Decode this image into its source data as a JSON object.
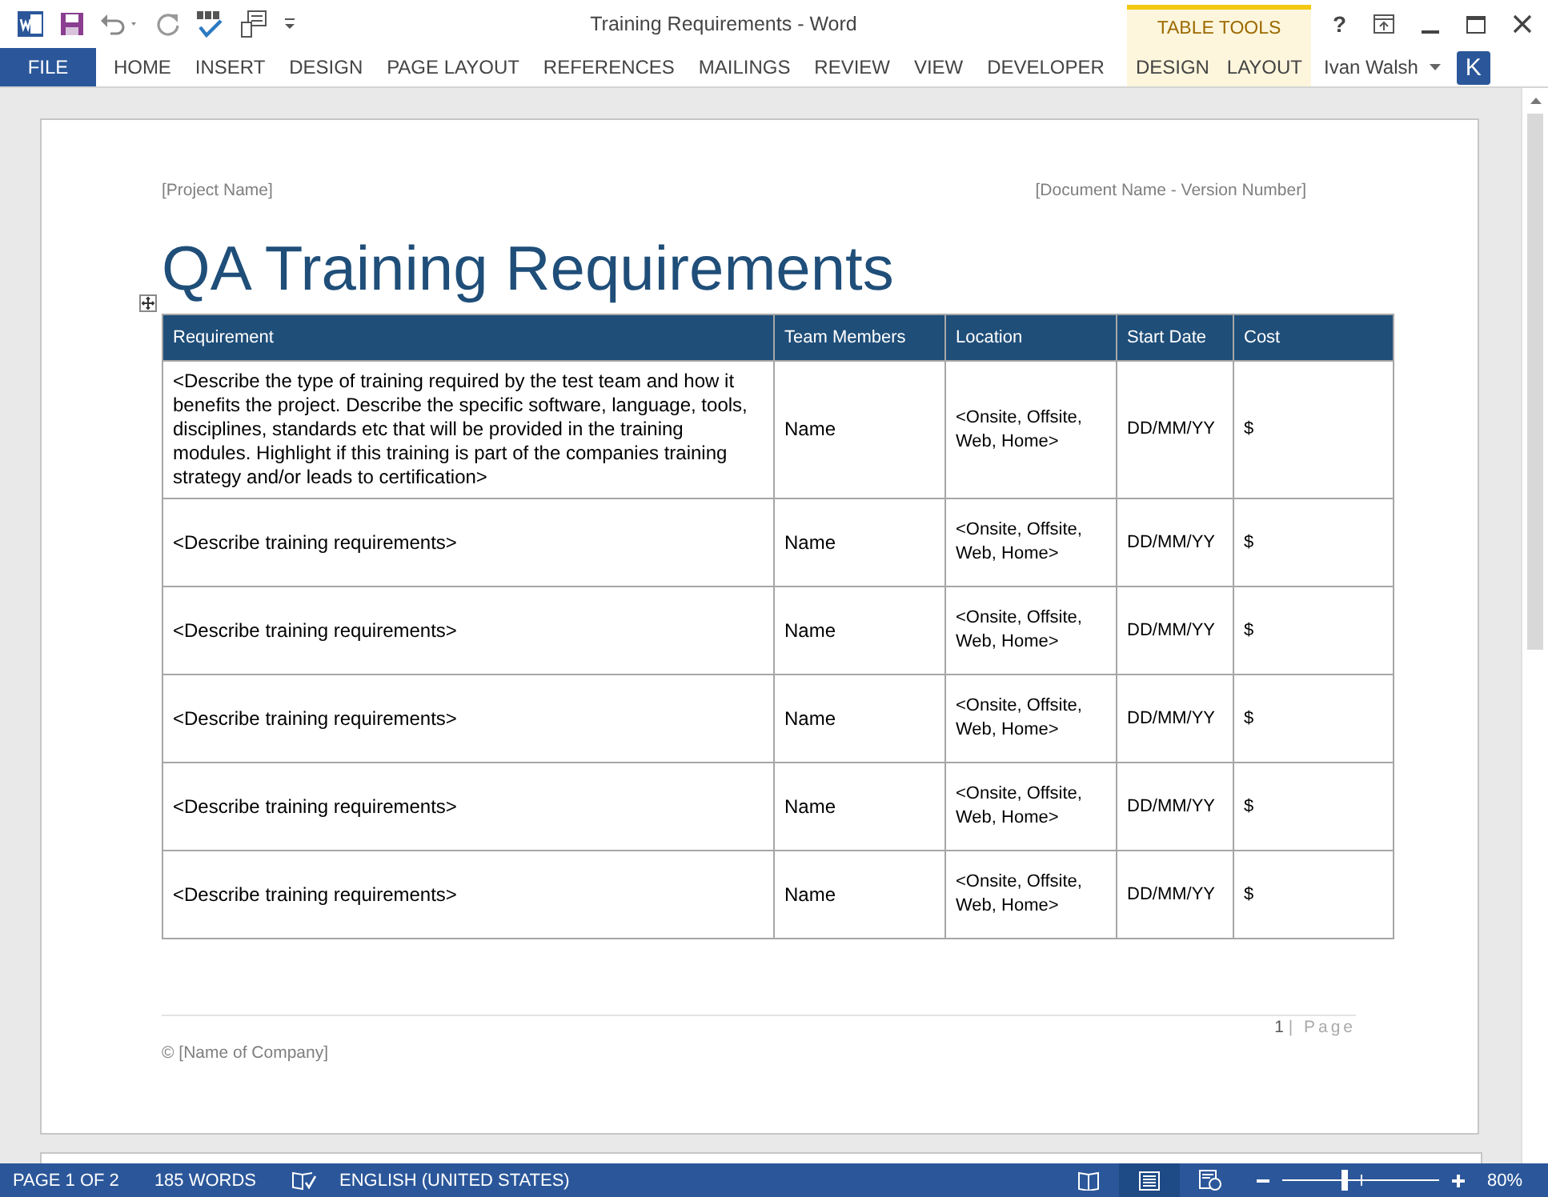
{
  "window": {
    "title": "Training Requirements - Word",
    "contextual_group": "TABLE TOOLS",
    "help": "?"
  },
  "ribbon_tabs": [
    {
      "label": "FILE",
      "kind": "file"
    },
    {
      "label": "HOME",
      "kind": "normal"
    },
    {
      "label": "INSERT",
      "kind": "normal"
    },
    {
      "label": "DESIGN",
      "kind": "normal"
    },
    {
      "label": "PAGE LAYOUT",
      "kind": "normal"
    },
    {
      "label": "REFERENCES",
      "kind": "normal"
    },
    {
      "label": "MAILINGS",
      "kind": "normal"
    },
    {
      "label": "REVIEW",
      "kind": "normal"
    },
    {
      "label": "VIEW",
      "kind": "normal"
    },
    {
      "label": "DEVELOPER",
      "kind": "normal"
    },
    {
      "label": "DESIGN",
      "kind": "contextual"
    },
    {
      "label": "LAYOUT",
      "kind": "contextual"
    }
  ],
  "user": {
    "name": "Ivan Walsh",
    "initial": "K"
  },
  "document": {
    "header_left": "[Project Name]",
    "header_right": "[Document Name - Version Number]",
    "title": "QA Training Requirements",
    "table": {
      "columns": [
        "Requirement",
        "Team Members",
        "Location",
        "Start Date",
        "Cost"
      ],
      "rows": [
        [
          "<Describe the type of training required by the test team and how it benefits the project. Describe the specific software, language, tools, disciplines, standards etc that will be provided in the training modules. Highlight if this training is part of the companies training strategy and/or leads to certification>",
          "Name",
          "<Onsite, Offsite, Web, Home>",
          "DD/MM/YY",
          "$"
        ],
        [
          "<Describe training requirements>",
          "Name",
          "<Onsite, Offsite, Web, Home>",
          "DD/MM/YY",
          "$"
        ],
        [
          "<Describe training requirements>",
          "Name",
          "<Onsite, Offsite, Web, Home>",
          "DD/MM/YY",
          "$"
        ],
        [
          "<Describe training requirements>",
          "Name",
          "<Onsite, Offsite, Web, Home>",
          "DD/MM/YY",
          "$"
        ],
        [
          "<Describe training requirements>",
          "Name",
          "<Onsite, Offsite, Web, Home>",
          "DD/MM/YY",
          "$"
        ],
        [
          "<Describe training requirements>",
          "Name",
          "<Onsite, Offsite, Web, Home>",
          "DD/MM/YY",
          "$"
        ]
      ]
    },
    "footer": {
      "page_number": "1",
      "page_label": "| Page",
      "company": "© [Name of Company]"
    }
  },
  "status_bar": {
    "page": "PAGE 1 OF 2",
    "words": "185 WORDS",
    "language": "ENGLISH (UNITED STATES)",
    "views": [
      {
        "kind": "read",
        "selected": false
      },
      {
        "kind": "print",
        "selected": true
      },
      {
        "kind": "web",
        "selected": false
      }
    ],
    "zoom_slider": {
      "level": 0.38
    },
    "zoom": "80%"
  }
}
